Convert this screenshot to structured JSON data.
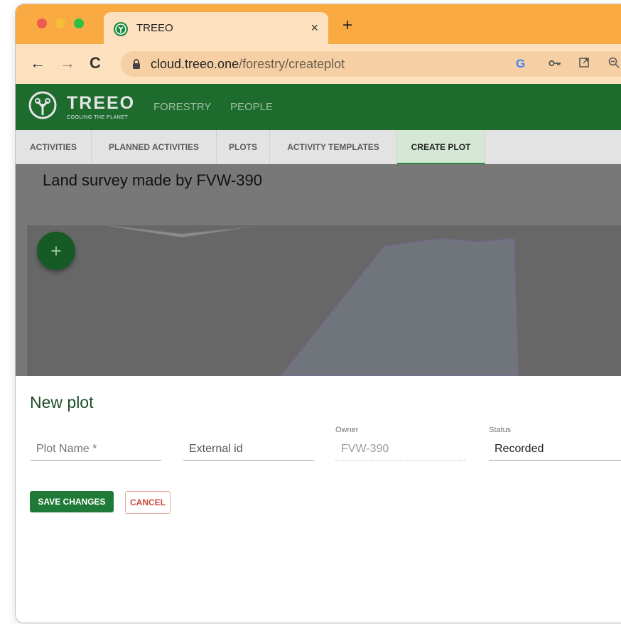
{
  "browser": {
    "tab_title": "TREEO",
    "tab_close": "×",
    "new_tab": "+",
    "url_host": "cloud.treeo.one",
    "url_path": "/forestry/createplot"
  },
  "app": {
    "logo_text": "TREEO",
    "logo_tagline": "COOLING THE PLANET",
    "nav": [
      "FORESTRY",
      "PEOPLE"
    ]
  },
  "subnav": {
    "tabs": [
      "ACTIVITIES",
      "PLANNED ACTIVITIES",
      "PLOTS",
      "ACTIVITY TEMPLATES",
      "CREATE PLOT"
    ],
    "active": "CREATE PLOT"
  },
  "content": {
    "survey_title": "Land survey made by FVW-390",
    "fab_label": "+"
  },
  "form": {
    "title": "New plot",
    "plot_name_placeholder": "Plot Name *",
    "external_id_placeholder": "External id",
    "owner_label": "Owner",
    "owner_value": "FVW-390",
    "status_label": "Status",
    "status_value": "Recorded",
    "save_label": "SAVE CHANGES",
    "cancel_label": "CANCEL"
  },
  "colors": {
    "tab_strip": "#f9aa43",
    "toolbar": "#fde1bf",
    "app_header": "#1e6b2e",
    "primary_button": "#1e7a36",
    "cancel_text": "#c94a3a"
  }
}
